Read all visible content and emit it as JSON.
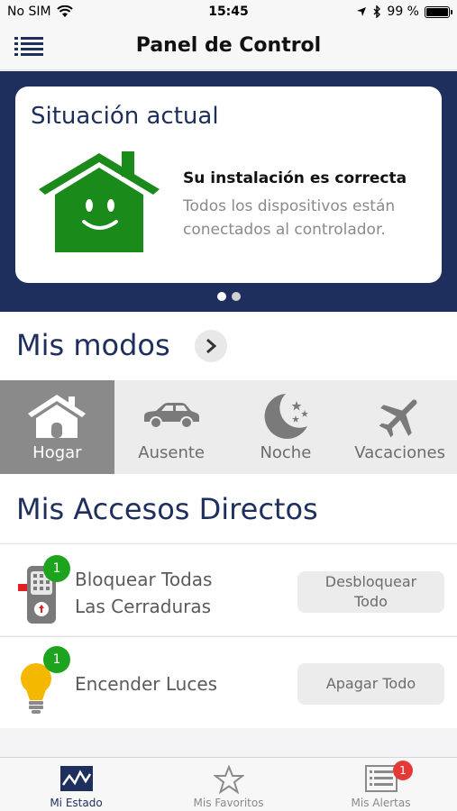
{
  "status_bar": {
    "carrier": "No SIM",
    "time": "15:45",
    "battery": "99 %",
    "battery_level": 0.99
  },
  "nav": {
    "title": "Panel de Control"
  },
  "status_card": {
    "title": "Situación actual",
    "headline": "Su instalación es correcta",
    "description": "Todos los dispositivos están conectados al controlador.",
    "house_color": "#1a8a1a"
  },
  "modes": {
    "title": "Mis modos",
    "items": [
      {
        "label": "Hogar",
        "icon": "house-icon",
        "active": true
      },
      {
        "label": "Ausente",
        "icon": "car-icon",
        "active": false
      },
      {
        "label": "Noche",
        "icon": "moon-icon",
        "active": false
      },
      {
        "label": "Vacaciones",
        "icon": "airplane-icon",
        "active": false
      }
    ]
  },
  "shortcuts": {
    "title": "Mis Accesos Directos",
    "items": [
      {
        "label_line1": "Bloquear Todas",
        "label_line2": "Las Cerraduras",
        "badge": "1",
        "action_line1": "Desbloquear",
        "action_line2": "Todo",
        "icon": "lock-icon"
      },
      {
        "label": "Encender Luces",
        "badge": "1",
        "action": "Apagar Todo",
        "icon": "bulb-icon"
      }
    ]
  },
  "tab_bar": {
    "tabs": [
      {
        "label": "Mi Estado",
        "icon": "chart-icon",
        "active": true
      },
      {
        "label": "Mis Favoritos",
        "icon": "star-icon",
        "active": false
      },
      {
        "label": "Mis Alertas",
        "icon": "list-icon",
        "active": false,
        "badge": "1"
      }
    ]
  },
  "colors": {
    "accent": "#1e2f5e",
    "success": "#1ea31e",
    "alert": "#e53935"
  }
}
